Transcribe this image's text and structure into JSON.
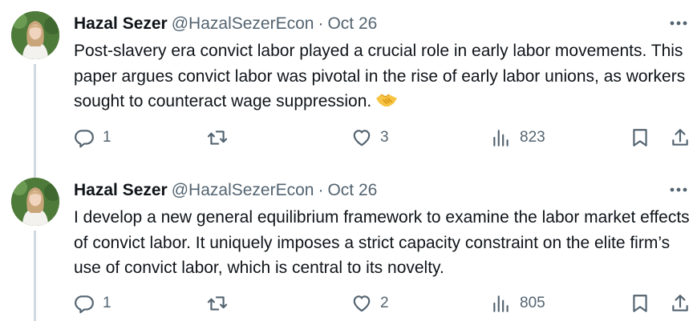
{
  "tweets": [
    {
      "author": {
        "name": "Hazal Sezer",
        "handle": "@HazalSezerEcon"
      },
      "separator": "·",
      "date": "Oct 26",
      "more_icon": "more-icon",
      "text": "Post-slavery era convict labor played a crucial role in early labor movements. This paper argues convict labor was pivotal in the rise of early labor unions, as workers sought to counteract wage suppression.",
      "emoji": "handshake-emoji",
      "counts": {
        "replies": "1",
        "reposts": "",
        "likes": "3",
        "views": "823"
      }
    },
    {
      "author": {
        "name": "Hazal Sezer",
        "handle": "@HazalSezerEcon"
      },
      "separator": "·",
      "date": "Oct 26",
      "more_icon": "more-icon",
      "text": "I develop a new general equilibrium framework to examine the labor market effects of convict labor. It uniquely imposes a strict capacity constraint on the elite firm’s use of convict labor, which is central to its novelty.",
      "counts": {
        "replies": "1",
        "reposts": "",
        "likes": "2",
        "views": "805"
      }
    }
  ],
  "colors": {
    "text": "#0f1419",
    "secondary": "#536471",
    "thread_line": "#cfd9de",
    "background": "#ffffff"
  }
}
